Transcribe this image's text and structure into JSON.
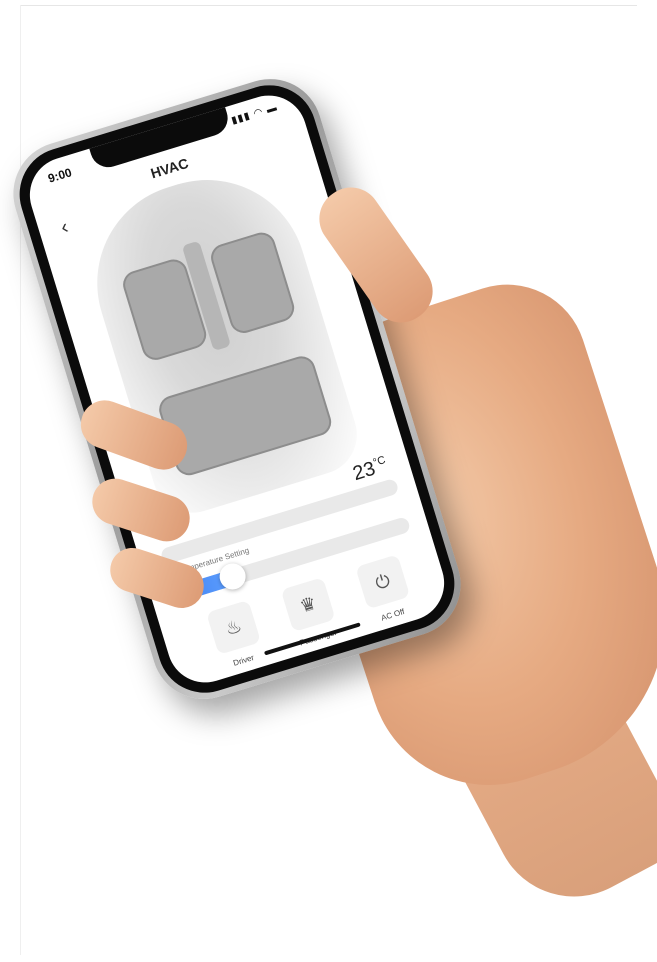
{
  "screen": {
    "status": {
      "time": "9:00"
    },
    "title": "HVAC",
    "icons": {
      "back": "back-chevron-icon",
      "status": "signal-wifi-battery-icon"
    },
    "temperature": {
      "value": "23",
      "unit": "°C"
    },
    "slider": {
      "label": "AC Temperature Setting",
      "level_percent": 25,
      "fill_color": "#4A8CF5"
    },
    "controls": [
      {
        "label": "Driver",
        "icon": "heated-seat-icon"
      },
      {
        "label": "Passenger",
        "icon": "seat-icon"
      },
      {
        "label": "AC Off",
        "icon": "power-icon"
      }
    ]
  }
}
